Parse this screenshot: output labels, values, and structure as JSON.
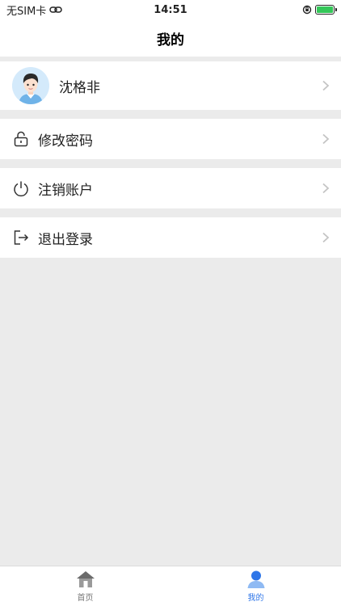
{
  "status_bar": {
    "carrier": "无SIM卡",
    "time": "14:51",
    "battery_color": "#34c759"
  },
  "nav": {
    "title": "我的"
  },
  "profile": {
    "name": "沈格非"
  },
  "menu": {
    "change_password": "修改密码",
    "cancel_account": "注销账户",
    "logout": "退出登录"
  },
  "tabs": [
    {
      "label": "首页",
      "icon": "home-icon",
      "active": false,
      "color": "#777777"
    },
    {
      "label": "我的",
      "icon": "person-icon",
      "active": true,
      "color": "#2f76e8"
    }
  ]
}
